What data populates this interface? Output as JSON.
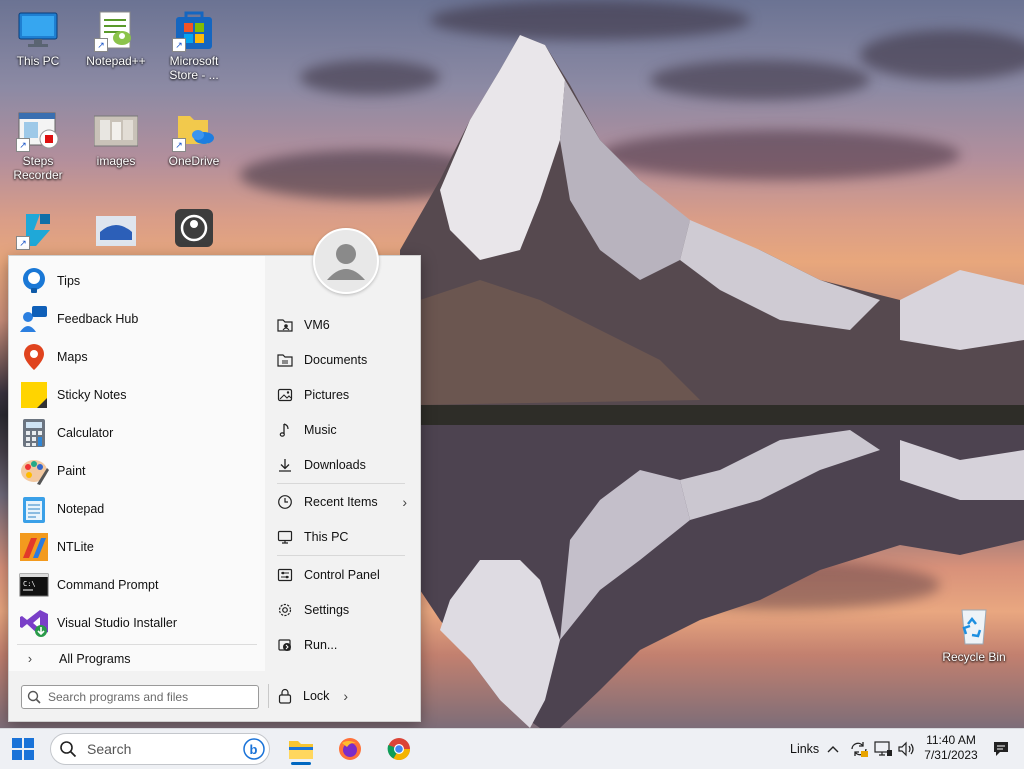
{
  "desktop": {
    "icons": [
      {
        "label": "This PC",
        "icon": "monitor-icon"
      },
      {
        "label": "Notepad++",
        "icon": "notepadpp-icon"
      },
      {
        "label": "Microsoft Store - ...",
        "icon": "store-icon"
      },
      {
        "label": "Steps Recorder",
        "icon": "steps-recorder-icon"
      },
      {
        "label": "images",
        "icon": "images-icon"
      },
      {
        "label": "OneDrive",
        "icon": "onedrive-folder-icon"
      },
      {
        "label": "",
        "icon": "app-icon"
      },
      {
        "label": "",
        "icon": "app-icon"
      },
      {
        "label": "",
        "icon": "app-icon"
      },
      {
        "label": "Recycle Bin",
        "icon": "recycle-bin-icon"
      }
    ]
  },
  "start_menu": {
    "programs": [
      {
        "label": "Tips",
        "icon": "tips-icon"
      },
      {
        "label": "Feedback Hub",
        "icon": "feedback-hub-icon"
      },
      {
        "label": "Maps",
        "icon": "maps-icon"
      },
      {
        "label": "Sticky Notes",
        "icon": "sticky-notes-icon"
      },
      {
        "label": "Calculator",
        "icon": "calculator-icon"
      },
      {
        "label": "Paint",
        "icon": "paint-icon"
      },
      {
        "label": "Notepad",
        "icon": "notepad-icon"
      },
      {
        "label": "NTLite",
        "icon": "ntlite-icon"
      },
      {
        "label": "Command Prompt",
        "icon": "cmd-icon"
      },
      {
        "label": "Visual Studio Installer",
        "icon": "vs-installer-icon"
      }
    ],
    "all_programs_label": "All Programs",
    "search_placeholder": "Search programs and files",
    "right_items": [
      {
        "label": "VM6",
        "icon": "user-folder-icon"
      },
      {
        "label": "Documents",
        "icon": "documents-icon"
      },
      {
        "label": "Pictures",
        "icon": "pictures-icon"
      },
      {
        "label": "Music",
        "icon": "music-icon"
      },
      {
        "label": "Downloads",
        "icon": "downloads-icon"
      },
      {
        "label": "Recent Items",
        "icon": "recent-icon"
      },
      {
        "label": "This PC",
        "icon": "this-pc-icon"
      },
      {
        "label": "Control Panel",
        "icon": "control-panel-icon"
      },
      {
        "label": "Settings",
        "icon": "settings-gear-icon"
      },
      {
        "label": "Run...",
        "icon": "run-icon"
      }
    ],
    "lock_label": "Lock"
  },
  "taskbar": {
    "search_placeholder": "Search",
    "apps": [
      "file-explorer-icon",
      "firefox-icon",
      "chrome-icon"
    ],
    "links_label": "Links",
    "time": "11:40 AM",
    "date": "7/31/2023"
  },
  "colors": {
    "accent": "#0067c0",
    "taskbar_bg": "#eef0f4",
    "start_bg": "#f2f2f2"
  }
}
